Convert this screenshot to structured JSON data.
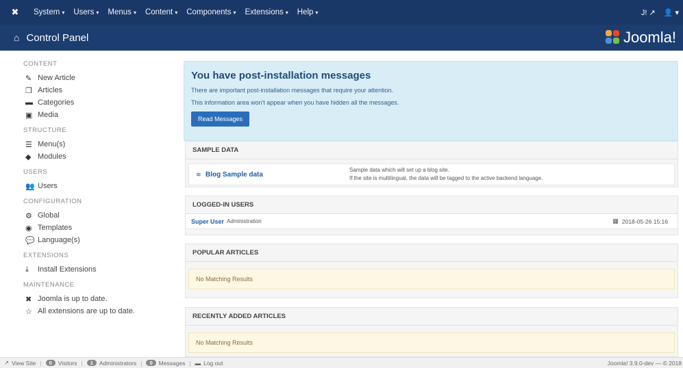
{
  "topbar": {
    "menu": [
      {
        "label": "System"
      },
      {
        "label": "Users"
      },
      {
        "label": "Menus"
      },
      {
        "label": "Content"
      },
      {
        "label": "Components"
      },
      {
        "label": "Extensions"
      },
      {
        "label": "Help"
      }
    ],
    "right_text": "J!"
  },
  "header": {
    "title": "Control Panel",
    "brand": "Joomla!"
  },
  "sidebar": {
    "sections": [
      {
        "heading": "CONTENT",
        "items": [
          {
            "label": "New Article",
            "icon": "pencil-icon"
          },
          {
            "label": "Articles",
            "icon": "stack-icon"
          },
          {
            "label": "Categories",
            "icon": "folder-icon"
          },
          {
            "label": "Media",
            "icon": "image-icon"
          }
        ]
      },
      {
        "heading": "STRUCTURE",
        "items": [
          {
            "label": "Menu(s)",
            "icon": "list-icon"
          },
          {
            "label": "Modules",
            "icon": "cube-icon"
          }
        ]
      },
      {
        "heading": "USERS",
        "items": [
          {
            "label": "Users",
            "icon": "users-icon"
          }
        ]
      },
      {
        "heading": "CONFIGURATION",
        "items": [
          {
            "label": "Global",
            "icon": "cog-icon"
          },
          {
            "label": "Templates",
            "icon": "eye-icon"
          },
          {
            "label": "Language(s)",
            "icon": "comments-icon"
          }
        ]
      },
      {
        "heading": "EXTENSIONS",
        "items": [
          {
            "label": "Install Extensions",
            "icon": "download-icon"
          }
        ]
      },
      {
        "heading": "MAINTENANCE",
        "items": [
          {
            "label": "Joomla is up to date.",
            "icon": "joomla-icon"
          },
          {
            "label": "All extensions are up to date.",
            "icon": "star-icon"
          }
        ]
      }
    ]
  },
  "alert": {
    "title": "You have post-installation messages",
    "line1": "There are important post-installation messages that require your attention.",
    "line2": "This information area won't appear when you have hidden all the messages.",
    "button": "Read Messages"
  },
  "sample_data": {
    "heading": "SAMPLE DATA",
    "item_label": "Blog Sample data",
    "desc1": "Sample data which will set up a blog site.",
    "desc2": "If the site is multilingual, the data will be tagged to the active backend language."
  },
  "logged_in": {
    "heading": "LOGGED-IN USERS",
    "user": "Super User",
    "area": "Administration",
    "date": "2018-05-26 15:16"
  },
  "popular": {
    "heading": "POPULAR ARTICLES",
    "empty": "No Matching Results"
  },
  "recent": {
    "heading": "RECENTLY ADDED ARTICLES",
    "empty": "No Matching Results"
  },
  "statusbar": {
    "view_site": "View Site",
    "visitors_count": "0",
    "visitors": "Visitors",
    "admins_count": "1",
    "admins": "Administrators",
    "messages_count": "0",
    "messages": "Messages",
    "logout": "Log out",
    "version": "Joomla! 3.9.0-dev — © 2018"
  },
  "colors": {
    "topbar": "#1a3867",
    "header": "#1c3d70",
    "link": "#1f5ea8",
    "alert_bg": "#d9edf7"
  }
}
